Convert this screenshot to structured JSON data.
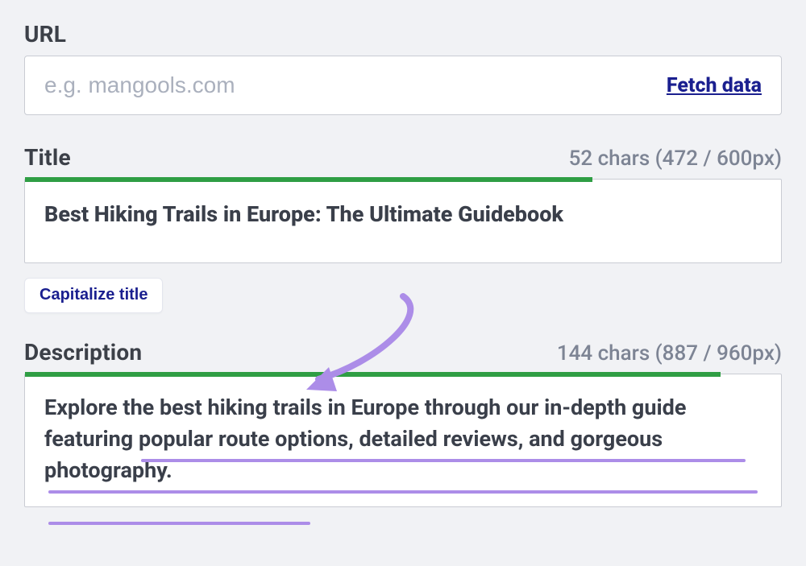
{
  "url_section": {
    "label": "URL",
    "placeholder": "e.g. mangools.com",
    "value": "",
    "fetch_label": "Fetch data"
  },
  "title_section": {
    "label": "Title",
    "char_info": "52 chars (472 / 600px)",
    "bar_percent": 75,
    "value": "Best Hiking Trails in Europe: The Ultimate Guidebook",
    "capitalize_label": "Capitalize title"
  },
  "description_section": {
    "label": "Description",
    "char_info": "144 chars (887 / 960px)",
    "bar_percent": 92,
    "value": "Explore the best hiking trails in Europe through our in-depth guide featuring popular route options, detailed reviews, and gorgeous photography."
  },
  "colors": {
    "green": "#2f9e44",
    "purple": "#ac8de8",
    "link_blue": "#1a1f8f"
  }
}
